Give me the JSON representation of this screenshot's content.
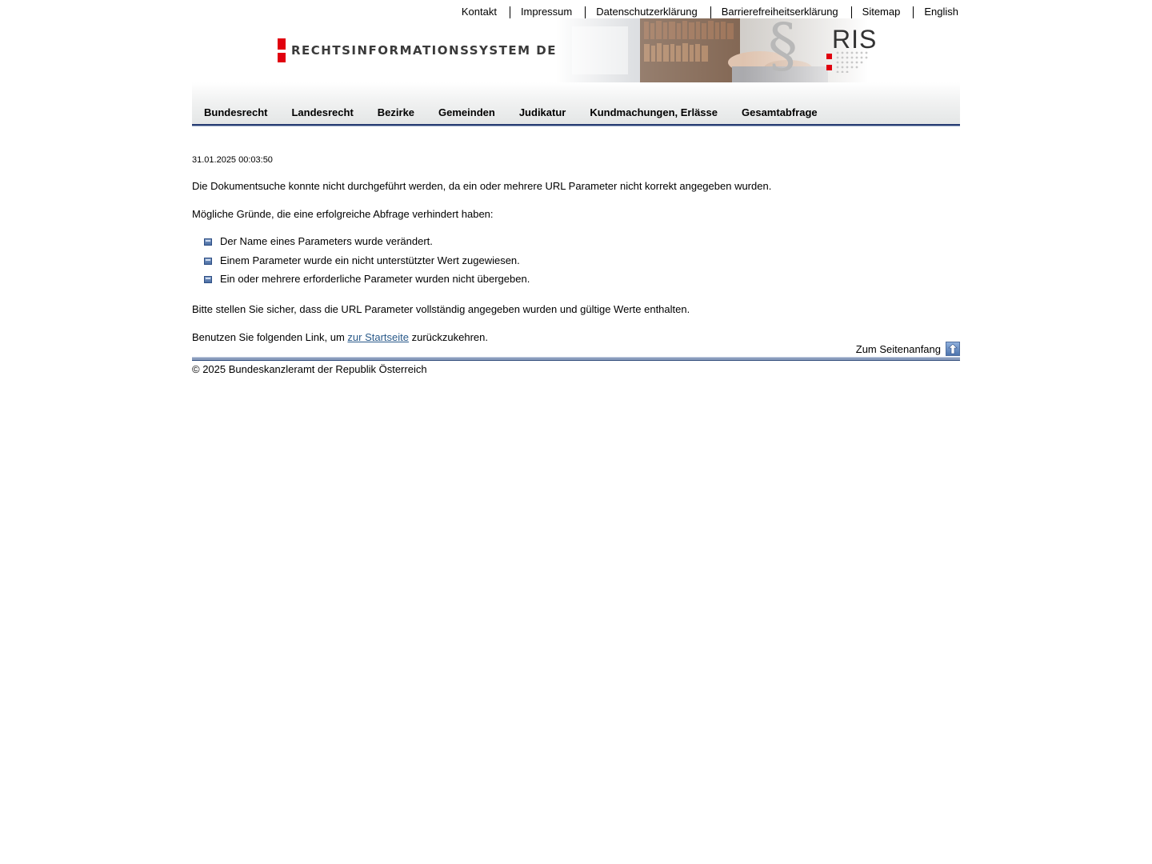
{
  "toplinks": {
    "kontakt": "Kontakt",
    "impressum": "Impressum",
    "datenschutz": "Datenschutzerklärung",
    "barrierefreiheit": "Barrierefreiheitserklärung",
    "sitemap": "Sitemap",
    "english": "English"
  },
  "banner": {
    "title": "RECHTSINFORMATIONSSYSTEM DES BUNDES",
    "logo_text": "RIS",
    "brand_red": "#e1000f"
  },
  "nav": {
    "items": [
      "Bundesrecht",
      "Landesrecht",
      "Bezirke",
      "Gemeinden",
      "Judikatur",
      "Kundmachungen, Erlässe",
      "Gesamtabfrage"
    ],
    "accent": "#273c73"
  },
  "content": {
    "timestamp": "31.01.2025 00:03:50",
    "error_message": "Die Dokumentsuche konnte nicht durchgeführt werden, da ein oder mehrere URL Parameter nicht korrekt angegeben wurden.",
    "reasons_intro": "Mögliche Gründe, die eine erfolgreiche Abfrage verhindert haben:",
    "reasons": [
      "Der Name eines Parameters wurde verändert.",
      "Einem Parameter wurde ein nicht unterstützter Wert zugewiesen.",
      "Ein oder mehrere erforderliche Parameter wurden nicht übergeben."
    ],
    "hint": "Bitte stellen Sie sicher, dass die URL Parameter vollständig angegeben wurden und gültige Werte enthalten.",
    "return_prefix": "Benutzen Sie folgenden Link, um ",
    "return_link": "zur Startseite",
    "return_suffix": " zurückzukehren."
  },
  "footer": {
    "to_top": "Zum Seitenanfang",
    "to_top_icon": "arrow-up-icon",
    "copyright": "© 2025 Bundeskanzleramt der Republik Österreich"
  }
}
